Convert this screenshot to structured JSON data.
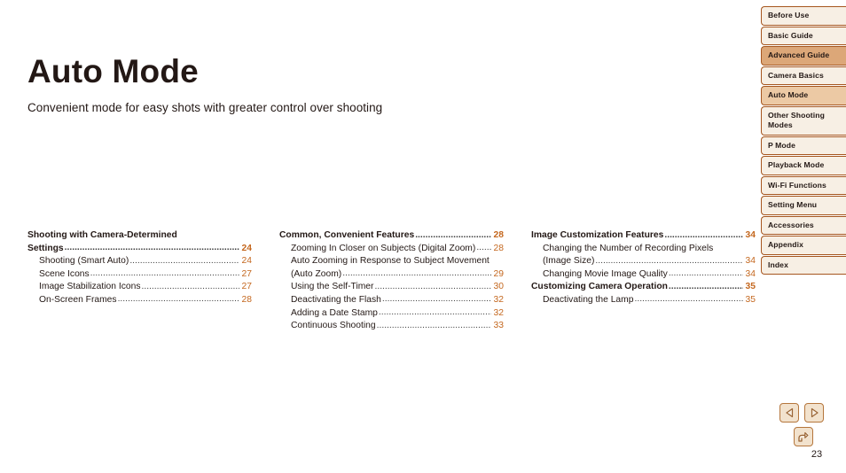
{
  "page": {
    "title": "Auto Mode",
    "subtitle": "Convenient mode for easy shots with greater control over shooting",
    "number": "23"
  },
  "colors": {
    "accent_page_number": "#c4671e",
    "text": "#231815",
    "tab_border": "#a6561f",
    "tab_light": "#f7efe4",
    "tab_mid": "#ecc9a4",
    "tab_strong": "#dca778",
    "button_border": "#b5763c",
    "button_fill": "#f2e2cd"
  },
  "toc": {
    "columns": [
      {
        "entries": [
          {
            "level": 1,
            "lines": [
              "Shooting with Camera-Determined",
              "Settings"
            ],
            "page": "24"
          },
          {
            "level": 2,
            "lines": [
              "Shooting (Smart Auto)"
            ],
            "page": "24"
          },
          {
            "level": 2,
            "lines": [
              "Scene Icons "
            ],
            "page": "27"
          },
          {
            "level": 2,
            "lines": [
              "Image Stabilization Icons "
            ],
            "page": "27"
          },
          {
            "level": 2,
            "lines": [
              "On-Screen Frames"
            ],
            "page": "28"
          }
        ]
      },
      {
        "entries": [
          {
            "level": 1,
            "lines": [
              "Common, Convenient Features "
            ],
            "page": "28"
          },
          {
            "level": 2,
            "lines": [
              "Zooming In Closer on Subjects (Digital Zoom) "
            ],
            "page": "28"
          },
          {
            "level": 2,
            "lines": [
              "Auto Zooming in Response to Subject Movement",
              "(Auto Zoom) "
            ],
            "page": "29"
          },
          {
            "level": 2,
            "lines": [
              "Using the Self-Timer"
            ],
            "page": "30"
          },
          {
            "level": 2,
            "lines": [
              "Deactivating the Flash"
            ],
            "page": "32"
          },
          {
            "level": 2,
            "lines": [
              "Adding a Date Stamp "
            ],
            "page": "32"
          },
          {
            "level": 2,
            "lines": [
              "Continuous Shooting"
            ],
            "page": "33"
          }
        ]
      },
      {
        "entries": [
          {
            "level": 1,
            "lines": [
              "Image Customization Features "
            ],
            "page": "34"
          },
          {
            "level": 2,
            "lines": [
              "Changing the Number of Recording Pixels",
              "(Image Size)"
            ],
            "page": "34"
          },
          {
            "level": 2,
            "lines": [
              "Changing Movie Image Quality "
            ],
            "page": "34"
          },
          {
            "level": 1,
            "lines": [
              "Customizing Camera Operation "
            ],
            "page": "35"
          },
          {
            "level": 2,
            "lines": [
              "Deactivating the Lamp "
            ],
            "page": "35"
          }
        ]
      }
    ]
  },
  "sidebar": {
    "items": [
      {
        "label": "Before Use",
        "tone": "light"
      },
      {
        "label": "Basic Guide",
        "tone": "light"
      },
      {
        "label": "Advanced Guide",
        "tone": "strong"
      },
      {
        "label": "Camera Basics",
        "tone": "light"
      },
      {
        "label": "Auto Mode",
        "tone": "mid"
      },
      {
        "label": "Other Shooting Modes",
        "tone": "light",
        "two_line": true
      },
      {
        "label": "P Mode",
        "tone": "light"
      },
      {
        "label": "Playback Mode",
        "tone": "light"
      },
      {
        "label": "Wi-Fi Functions",
        "tone": "light"
      },
      {
        "label": "Setting Menu",
        "tone": "light"
      },
      {
        "label": "Accessories",
        "tone": "light"
      },
      {
        "label": "Appendix",
        "tone": "light"
      },
      {
        "label": "Index",
        "tone": "light"
      }
    ]
  },
  "nav": {
    "previous_label": "previous-page",
    "next_label": "next-page",
    "return_label": "return-to-previous-view"
  }
}
